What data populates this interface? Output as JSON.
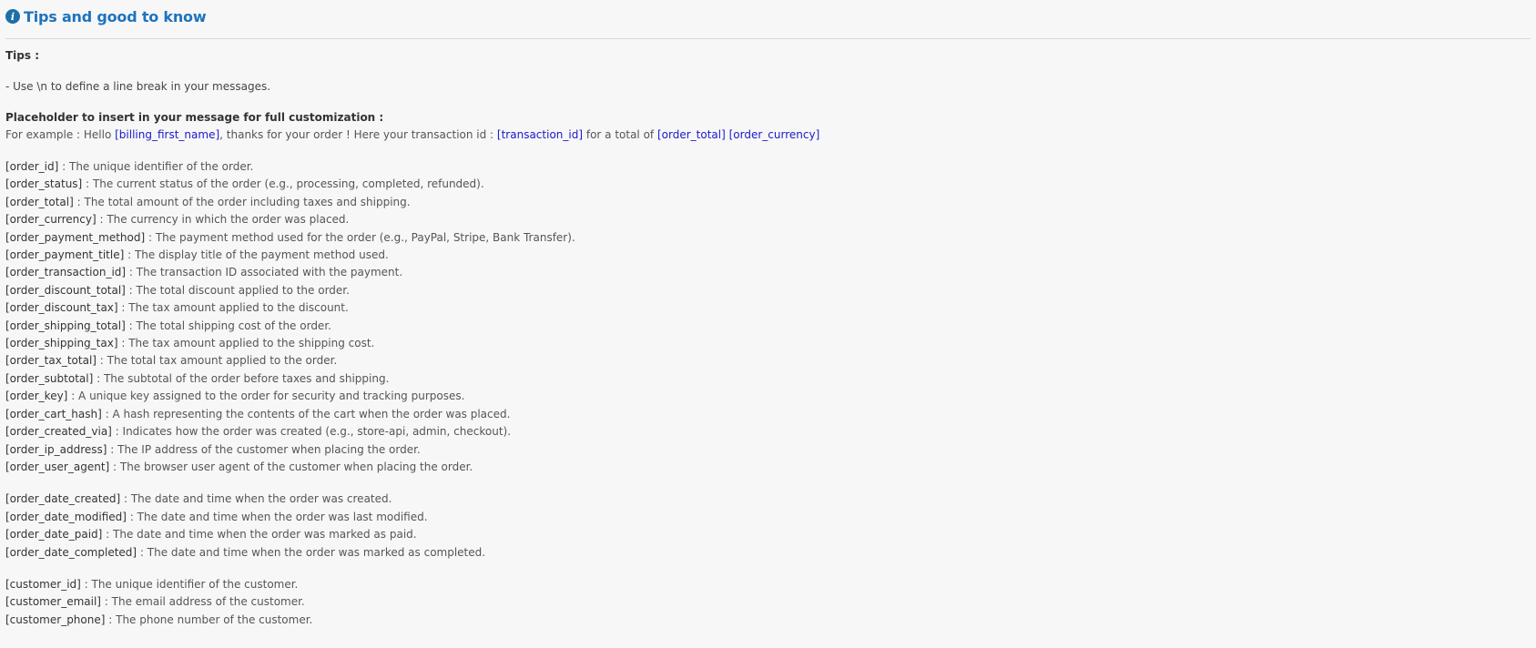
{
  "header": {
    "icon": "info-icon",
    "icon_glyph": "i",
    "title": "Tips and good to know"
  },
  "tips": {
    "heading": "Tips :",
    "line": "- Use \\n to define a line break in your messages."
  },
  "placeholders": {
    "heading": "Placeholder to insert in your message for full customization :",
    "example": {
      "label": "For example :",
      "t1": " Hello ",
      "p1": "[billing_first_name]",
      "t2": ", thanks for your order ! Here your transaction id : ",
      "p2": "[transaction_id]",
      "t3": " for a total of ",
      "p3": "[order_total]",
      "t4": " ",
      "p4": "[order_currency]"
    },
    "groups": [
      [
        {
          "key": "[order_id]",
          "desc": " : The unique identifier of the order."
        },
        {
          "key": "[order_status]",
          "desc": " : The current status of the order (e.g., processing, completed, refunded)."
        },
        {
          "key": "[order_total]",
          "desc": " : The total amount of the order including taxes and shipping."
        },
        {
          "key": "[order_currency]",
          "desc": " : The currency in which the order was placed."
        },
        {
          "key": "[order_payment_method]",
          "desc": " : The payment method used for the order (e.g., PayPal, Stripe, Bank Transfer)."
        },
        {
          "key": "[order_payment_title]",
          "desc": " : The display title of the payment method used."
        },
        {
          "key": "[order_transaction_id]",
          "desc": " : The transaction ID associated with the payment."
        },
        {
          "key": "[order_discount_total]",
          "desc": " : The total discount applied to the order."
        },
        {
          "key": "[order_discount_tax]",
          "desc": " : The tax amount applied to the discount."
        },
        {
          "key": "[order_shipping_total]",
          "desc": " : The total shipping cost of the order."
        },
        {
          "key": "[order_shipping_tax]",
          "desc": " : The tax amount applied to the shipping cost."
        },
        {
          "key": "[order_tax_total]",
          "desc": " : The total tax amount applied to the order."
        },
        {
          "key": "[order_subtotal]",
          "desc": " : The subtotal of the order before taxes and shipping."
        },
        {
          "key": "[order_key]",
          "desc": " : A unique key assigned to the order for security and tracking purposes."
        },
        {
          "key": "[order_cart_hash]",
          "desc": " : A hash representing the contents of the cart when the order was placed."
        },
        {
          "key": "[order_created_via]",
          "desc": " : Indicates how the order was created (e.g., store-api, admin, checkout)."
        },
        {
          "key": "[order_ip_address]",
          "desc": " : The IP address of the customer when placing the order."
        },
        {
          "key": "[order_user_agent]",
          "desc": " : The browser user agent of the customer when placing the order."
        }
      ],
      [
        {
          "key": "[order_date_created]",
          "desc": " : The date and time when the order was created."
        },
        {
          "key": "[order_date_modified]",
          "desc": " : The date and time when the order was last modified."
        },
        {
          "key": "[order_date_paid]",
          "desc": " : The date and time when the order was marked as paid."
        },
        {
          "key": "[order_date_completed]",
          "desc": " : The date and time when the order was marked as completed."
        }
      ],
      [
        {
          "key": "[customer_id]",
          "desc": " : The unique identifier of the customer."
        },
        {
          "key": "[customer_email]",
          "desc": " : The email address of the customer."
        },
        {
          "key": "[customer_phone]",
          "desc": " : The phone number of the customer."
        }
      ]
    ]
  },
  "colors": {
    "title": "#1e73be",
    "icon_bg": "#1e6fa8",
    "placeholder": "#1a1acc",
    "text": "#555555",
    "background": "#f7f7f7"
  }
}
